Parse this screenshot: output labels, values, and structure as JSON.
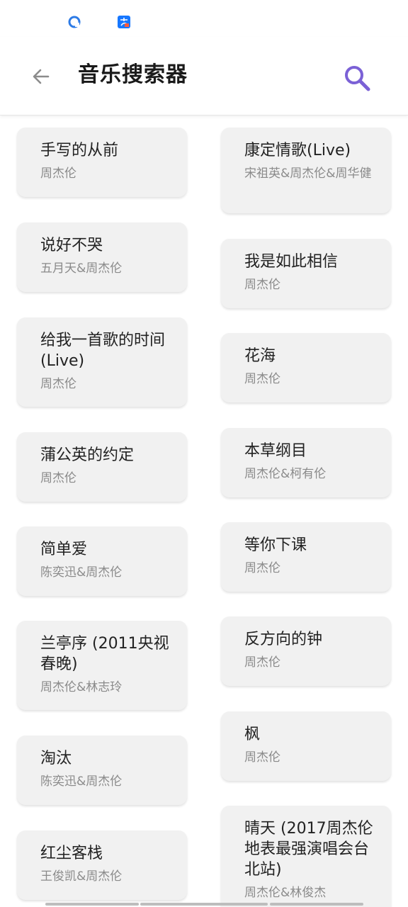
{
  "app": {
    "title": "音乐搜索器"
  },
  "colors": {
    "accent": "#7b61d6",
    "card_bg": "#f1f1f1",
    "artist_text": "#8a8a8a"
  },
  "left_column": [
    {
      "title": "手写的从前",
      "artist": "周杰伦"
    },
    {
      "title": "说好不哭",
      "artist": "五月天&周杰伦"
    },
    {
      "title": "给我一首歌的时间 (Live)",
      "artist": "周杰伦"
    },
    {
      "title": "蒲公英的约定",
      "artist": "周杰伦"
    },
    {
      "title": "简单爱",
      "artist": "陈奕迅&周杰伦"
    },
    {
      "title": "兰亭序 (2011央视春晚)",
      "artist": "周杰伦&林志玲"
    },
    {
      "title": "淘汰",
      "artist": "陈奕迅&周杰伦"
    },
    {
      "title": "红尘客栈",
      "artist": "王俊凯&周杰伦"
    }
  ],
  "right_column": [
    {
      "title": "康定情歌(Live)",
      "artist": "宋祖英&周杰伦&周华健"
    },
    {
      "title": "我是如此相信",
      "artist": "周杰伦"
    },
    {
      "title": "花海",
      "artist": "周杰伦"
    },
    {
      "title": "本草纲目",
      "artist": "周杰伦&柯有伦"
    },
    {
      "title": "等你下课",
      "artist": "周杰伦"
    },
    {
      "title": "反方向的钟",
      "artist": "周杰伦"
    },
    {
      "title": "枫",
      "artist": "周杰伦"
    },
    {
      "title": "晴天 (2017周杰伦地表最强演唱会台北站)",
      "artist": "周杰伦&林俊杰"
    }
  ]
}
